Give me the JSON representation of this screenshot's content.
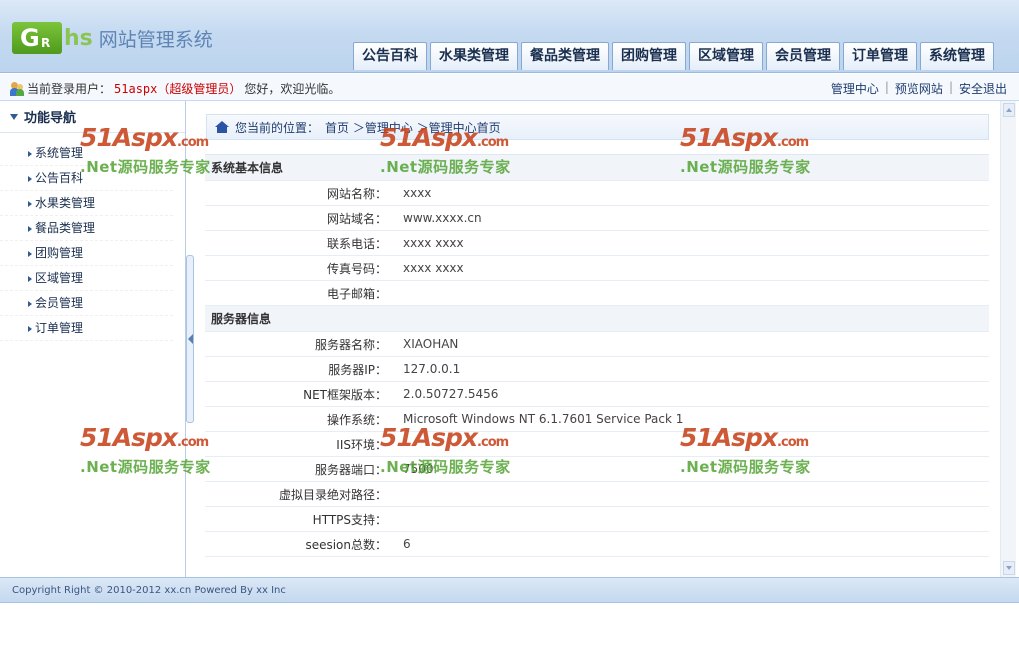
{
  "header": {
    "logo_badge": "G",
    "logo_badge_small": "R",
    "logo_hs": "hs",
    "logo_text": "网站管理系统",
    "tabs": [
      "公告百科",
      "水果类管理",
      "餐品类管理",
      "团购管理",
      "区域管理",
      "会员管理",
      "订单管理",
      "系统管理"
    ]
  },
  "status": {
    "prefix": "当前登录用户：",
    "username": "51aspx（超级管理员）",
    "suffix": "您好，欢迎光临。",
    "links": [
      "管理中心",
      "预览网站",
      "安全退出"
    ],
    "separator": "|"
  },
  "sidebar": {
    "title": "功能导航",
    "items": [
      "系统管理",
      "公告百科",
      "水果类管理",
      "餐品类管理",
      "团购管理",
      "区域管理",
      "会员管理",
      "订单管理"
    ]
  },
  "breadcrumb": {
    "prefix": "您当前的位置：",
    "path": "首页 ＞管理中心 ＞管理中心首页"
  },
  "basic_info": {
    "title": "系统基本信息",
    "rows": [
      {
        "k": "网站名称：",
        "v": "xxxx"
      },
      {
        "k": "网站域名：",
        "v": "www.xxxx.cn"
      },
      {
        "k": "联系电话：",
        "v": "xxxx xxxx"
      },
      {
        "k": "传真号码：",
        "v": "xxxx xxxx"
      },
      {
        "k": "电子邮箱：",
        "v": ""
      }
    ]
  },
  "server_info": {
    "title": "服务器信息",
    "rows": [
      {
        "k": "服务器名称：",
        "v": "XIAOHAN"
      },
      {
        "k": "服务器IP：",
        "v": "127.0.0.1"
      },
      {
        "k": "NET框架版本：",
        "v": "2.0.50727.5456"
      },
      {
        "k": "操作系统：",
        "v": "Microsoft Windows NT 6.1.7601 Service Pack 1"
      },
      {
        "k": "IIS环境：",
        "v": ""
      },
      {
        "k": "服务器端口：",
        "v": "7500"
      },
      {
        "k": "虚拟目录绝对路径：",
        "v": ""
      },
      {
        "k": "HTTPS支持：",
        "v": ""
      },
      {
        "k": "seesion总数：",
        "v": "6"
      }
    ]
  },
  "watermark": {
    "big": "51Aspx",
    "com": ".com",
    "small": ".Net源码服务专家"
  },
  "footer": {
    "text": "Copyright Right © 2010-2012 xx.cn Powered By xx Inc"
  }
}
